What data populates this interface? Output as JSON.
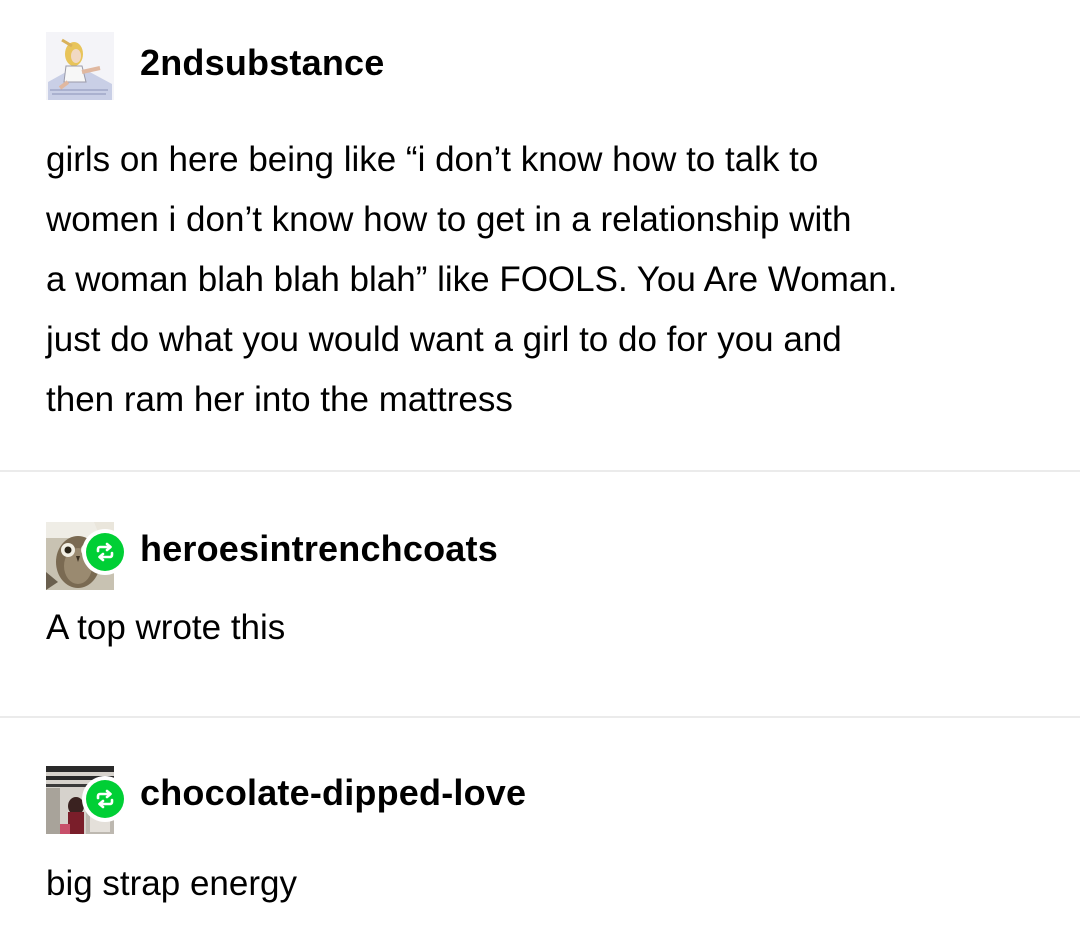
{
  "posts": [
    {
      "username": "2ndsubstance",
      "avatar_icon": "illustrated-person-avatar",
      "reblog": false,
      "lines": [
        "girls on here being like “i don’t know how to talk to",
        "women i don’t know how to get in a relationship with",
        "a woman blah blah blah” like FOOLS. You Are Woman.",
        "just do what you would want a girl to do for you and",
        "then ram her into the mattress"
      ]
    },
    {
      "username": "heroesintrenchcoats",
      "avatar_icon": "owl-photo-avatar",
      "reblog": true,
      "lines": [
        "A top wrote this"
      ]
    },
    {
      "username": "chocolate-dipped-love",
      "avatar_icon": "hallway-photo-avatar",
      "reblog": true,
      "lines": [
        "big strap energy"
      ]
    }
  ],
  "colors": {
    "reblog_green": "#00cf35",
    "divider": "#ebebeb",
    "text": "#000000"
  }
}
